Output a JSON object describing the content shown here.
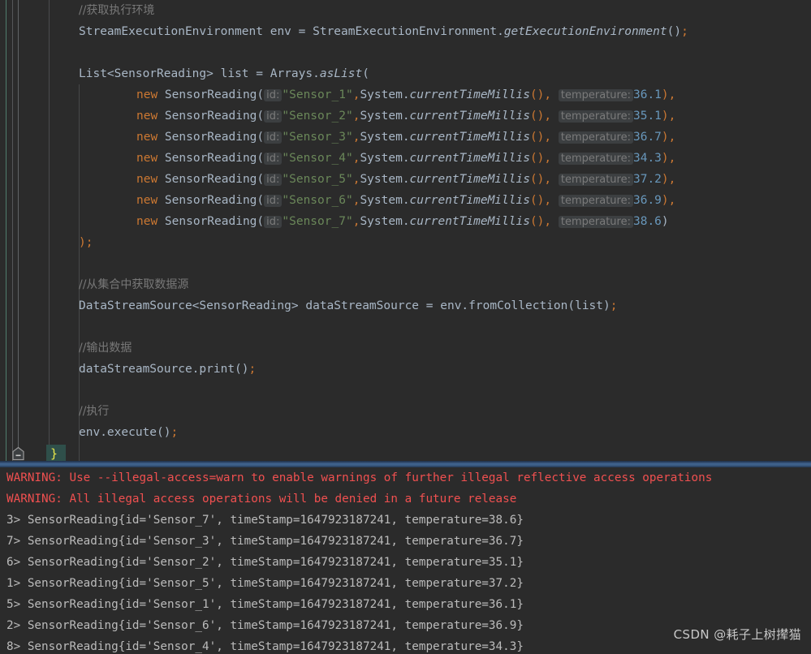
{
  "editor": {
    "language": "java",
    "theme": "darcula",
    "lines": [
      {
        "type": "comment",
        "indent": "shallow",
        "text": "//获取执行环境"
      },
      {
        "type": "code",
        "indent": "shallow",
        "text": "StreamExecutionEnvironment env = StreamExecutionEnvironment.getExecutionEnvironment();"
      },
      {
        "type": "blank",
        "indent": "shallow",
        "text": ""
      },
      {
        "type": "code",
        "indent": "shallow",
        "text": "List<SensorReading> list = Arrays.asList("
      },
      {
        "type": "code",
        "indent": "deep",
        "text": "new SensorReading( id: \"Sensor_1\",System.currentTimeMillis(), temperature: 36.1),"
      },
      {
        "type": "code",
        "indent": "deep",
        "text": "new SensorReading( id: \"Sensor_2\",System.currentTimeMillis(), temperature: 35.1),"
      },
      {
        "type": "code",
        "indent": "deep",
        "text": "new SensorReading( id: \"Sensor_3\",System.currentTimeMillis(), temperature: 36.7),"
      },
      {
        "type": "code",
        "indent": "deep",
        "text": "new SensorReading( id: \"Sensor_4\",System.currentTimeMillis(), temperature: 34.3),"
      },
      {
        "type": "code",
        "indent": "deep",
        "text": "new SensorReading( id: \"Sensor_5\",System.currentTimeMillis(), temperature: 37.2),"
      },
      {
        "type": "code",
        "indent": "deep",
        "text": "new SensorReading( id: \"Sensor_6\",System.currentTimeMillis(), temperature: 36.9),"
      },
      {
        "type": "code",
        "indent": "deep",
        "text": "new SensorReading( id: \"Sensor_7\",System.currentTimeMillis(), temperature: 38.6)"
      },
      {
        "type": "code",
        "indent": "shallow",
        "text": ");"
      },
      {
        "type": "blank",
        "indent": "shallow",
        "text": ""
      },
      {
        "type": "comment",
        "indent": "shallow",
        "text": "//从集合中获取数据源"
      },
      {
        "type": "code",
        "indent": "shallow",
        "text": "DataStreamSource<SensorReading> dataStreamSource = env.fromCollection(list);"
      },
      {
        "type": "blank",
        "indent": "shallow",
        "text": ""
      },
      {
        "type": "comment",
        "indent": "shallow",
        "text": "//输出数据"
      },
      {
        "type": "code",
        "indent": "shallow",
        "text": "dataStreamSource.print();"
      },
      {
        "type": "blank",
        "indent": "shallow",
        "text": ""
      },
      {
        "type": "comment",
        "indent": "shallow",
        "text": "//执行"
      },
      {
        "type": "code",
        "indent": "shallow",
        "text": "env.execute();"
      }
    ],
    "comments": {
      "get_env": "//获取执行环境",
      "collection_source": "//从集合中获取数据源",
      "print_data": "//输出数据",
      "execute": "//执行"
    },
    "statements": {
      "env_decl_type": "StreamExecutionEnvironment",
      "env_decl_var": " env ",
      "env_decl_eq": "= ",
      "env_decl_class": "StreamExecutionEnvironment",
      "env_decl_dot": ".",
      "env_decl_method": "getExecutionEnvironment",
      "env_decl_parens": "()",
      "env_decl_semi": ";",
      "list_type": "List<SensorReading>",
      "list_var": " list ",
      "list_eq": "= ",
      "list_class": "Arrays",
      "list_dot": ".",
      "list_method": "asList",
      "list_open": "(",
      "list_close": ");",
      "dss_type": "DataStreamSource<SensorReading>",
      "dss_var": " dataStreamSource ",
      "dss_eq": "= ",
      "dss_call": "env.fromCollection(list)",
      "dss_semi": ";",
      "print_call": "dataStreamSource.print()",
      "print_semi": ";",
      "execute_call": "env.execute()",
      "execute_semi": ";",
      "closing_brace": "}"
    },
    "sensor_rows": [
      {
        "kw": "new ",
        "ctor": "SensorReading(",
        "hint_id": "id:",
        "id": "\"Sensor_1\"",
        "comma1": ",",
        "ts": "System.",
        "ts_method": "currentTimeMillis",
        "ts_parens": "(),",
        "hint_temp": "temperature:",
        "temp": "36.1",
        "tail": "),"
      },
      {
        "kw": "new ",
        "ctor": "SensorReading(",
        "hint_id": "id:",
        "id": "\"Sensor_2\"",
        "comma1": ",",
        "ts": "System.",
        "ts_method": "currentTimeMillis",
        "ts_parens": "(),",
        "hint_temp": "temperature:",
        "temp": "35.1",
        "tail": "),"
      },
      {
        "kw": "new ",
        "ctor": "SensorReading(",
        "hint_id": "id:",
        "id": "\"Sensor_3\"",
        "comma1": ",",
        "ts": "System.",
        "ts_method": "currentTimeMillis",
        "ts_parens": "(),",
        "hint_temp": "temperature:",
        "temp": "36.7",
        "tail": "),"
      },
      {
        "kw": "new ",
        "ctor": "SensorReading(",
        "hint_id": "id:",
        "id": "\"Sensor_4\"",
        "comma1": ",",
        "ts": "System.",
        "ts_method": "currentTimeMillis",
        "ts_parens": "(),",
        "hint_temp": "temperature:",
        "temp": "34.3",
        "tail": "),"
      },
      {
        "kw": "new ",
        "ctor": "SensorReading(",
        "hint_id": "id:",
        "id": "\"Sensor_5\"",
        "comma1": ",",
        "ts": "System.",
        "ts_method": "currentTimeMillis",
        "ts_parens": "(),",
        "hint_temp": "temperature:",
        "temp": "37.2",
        "tail": "),"
      },
      {
        "kw": "new ",
        "ctor": "SensorReading(",
        "hint_id": "id:",
        "id": "\"Sensor_6\"",
        "comma1": ",",
        "ts": "System.",
        "ts_method": "currentTimeMillis",
        "ts_parens": "(),",
        "hint_temp": "temperature:",
        "temp": "36.9",
        "tail": "),"
      },
      {
        "kw": "new ",
        "ctor": "SensorReading(",
        "hint_id": "id:",
        "id": "\"Sensor_7\"",
        "comma1": ",",
        "ts": "System.",
        "ts_method": "currentTimeMillis",
        "ts_parens": "(),",
        "hint_temp": "temperature:",
        "temp": "38.6",
        "tail": ")"
      }
    ]
  },
  "console": {
    "lines": [
      {
        "kind": "warning",
        "text": "WARNING: Use --illegal-access=warn to enable warnings of further illegal reflective access operations"
      },
      {
        "kind": "warning",
        "text": "WARNING: All illegal access operations will be denied in a future release"
      },
      {
        "kind": "output",
        "text": "3> SensorReading{id='Sensor_7', timeStamp=1647923187241, temperature=38.6}"
      },
      {
        "kind": "output",
        "text": "7> SensorReading{id='Sensor_3', timeStamp=1647923187241, temperature=36.7}"
      },
      {
        "kind": "output",
        "text": "6> SensorReading{id='Sensor_2', timeStamp=1647923187241, temperature=35.1}"
      },
      {
        "kind": "output",
        "text": "1> SensorReading{id='Sensor_5', timeStamp=1647923187241, temperature=37.2}"
      },
      {
        "kind": "output",
        "text": "5> SensorReading{id='Sensor_1', timeStamp=1647923187241, temperature=36.1}"
      },
      {
        "kind": "output",
        "text": "2> SensorReading{id='Sensor_6', timeStamp=1647923187241, temperature=36.9}"
      },
      {
        "kind": "output",
        "text": "8> SensorReading{id='Sensor_4', timeStamp=1647923187241, temperature=34.3}"
      }
    ]
  },
  "watermark": {
    "text": "CSDN @耗子上树撵猫"
  },
  "colors": {
    "background": "#2b2b2b",
    "default_text": "#a9b7c6",
    "keyword": "#cc7832",
    "string": "#6a8759",
    "number": "#6897bb",
    "comment": "#787878",
    "hint_chip_bg": "#3c3f41",
    "hint_chip_text": "#7a7a7a",
    "warning": "#f05050",
    "console_text": "#bbbbbb",
    "divider": "#41648f",
    "brace_highlight": "#2f4f4a",
    "brace_text": "#e8e84a",
    "guide_teal": "#4f7d6d",
    "guide_gray": "#555659"
  }
}
